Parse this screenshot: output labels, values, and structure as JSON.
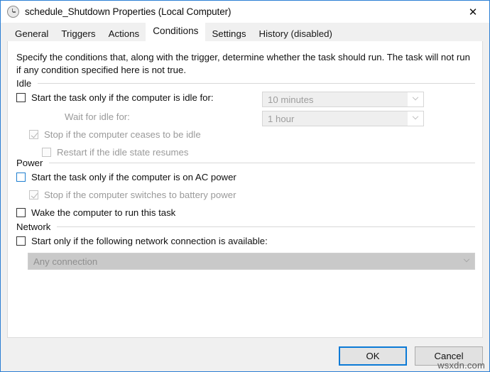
{
  "window": {
    "title": "schedule_Shutdown Properties (Local Computer)",
    "icon": "clock-icon",
    "close_label": "✕",
    "accent_color": "#2c7fd4"
  },
  "tabs": [
    {
      "label": "General",
      "selected": false,
      "disabled": false
    },
    {
      "label": "Triggers",
      "selected": false,
      "disabled": false
    },
    {
      "label": "Actions",
      "selected": false,
      "disabled": false
    },
    {
      "label": "Conditions",
      "selected": true,
      "disabled": false
    },
    {
      "label": "Settings",
      "selected": false,
      "disabled": false
    },
    {
      "label": "History (disabled)",
      "selected": false,
      "disabled": true
    }
  ],
  "conditions": {
    "description": "Specify the conditions that, along with the trigger, determine whether the task should run.  The task will not run  if any condition specified here is not true.",
    "groups": {
      "idle": {
        "label": "Idle",
        "start_if_idle": {
          "label": "Start the task only if the computer is idle for:",
          "checked": false,
          "enabled": true
        },
        "idle_duration": {
          "value": "10 minutes",
          "enabled": false
        },
        "wait_for_idle_label": {
          "label": "Wait for idle for:",
          "enabled": false
        },
        "wait_duration": {
          "value": "1 hour",
          "enabled": false
        },
        "stop_if_ceases_idle": {
          "label": "Stop if the computer ceases to be idle",
          "checked": true,
          "enabled": false
        },
        "restart_if_idle_resumes": {
          "label": "Restart if the idle state resumes",
          "checked": false,
          "enabled": false
        }
      },
      "power": {
        "label": "Power",
        "start_if_ac_power": {
          "label": "Start the task only if the computer is on AC power",
          "checked": false,
          "enabled": true,
          "focused": true
        },
        "stop_if_battery": {
          "label": "Stop if the computer switches to battery power",
          "checked": true,
          "enabled": false
        },
        "wake_computer": {
          "label": "Wake the computer to run this task",
          "checked": false,
          "enabled": true
        }
      },
      "network": {
        "label": "Network",
        "start_if_network": {
          "label": "Start only if the following network connection is available:",
          "checked": false,
          "enabled": true
        },
        "connection": {
          "value": "Any connection",
          "enabled": false
        }
      }
    }
  },
  "footer": {
    "ok_label": "OK",
    "cancel_label": "Cancel"
  },
  "watermark": "wsxdn.com"
}
